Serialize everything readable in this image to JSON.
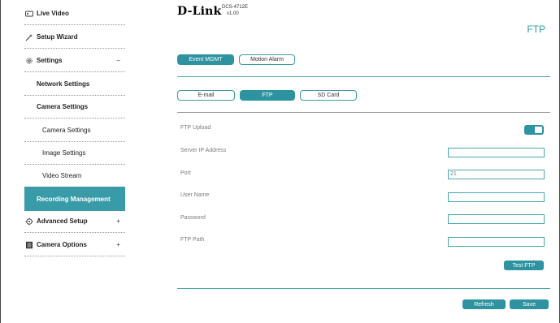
{
  "sidebar": {
    "items": [
      {
        "label": "Live Video",
        "icon": "live-video-icon"
      },
      {
        "label": "Setup Wizard",
        "icon": "wizard-icon"
      },
      {
        "label": "Settings",
        "icon": "gear-icon",
        "sign": "–"
      },
      {
        "label": "Network Settings"
      },
      {
        "label": "Camera Settings"
      },
      {
        "label": "Camera Settings"
      },
      {
        "label": "Image Settings"
      },
      {
        "label": "Video Stream"
      },
      {
        "label": "Recording Management"
      },
      {
        "label": "Advanced Setup",
        "icon": "advanced-setup-icon",
        "sign": "+"
      },
      {
        "label": "Camera Options",
        "icon": "camera-options-icon",
        "sign": "+"
      }
    ]
  },
  "header": {
    "logo": "D-Link",
    "model": "DCS-4712E",
    "version": "v1.00",
    "page_title": "FTP"
  },
  "tabs": {
    "primary": [
      "Event MGMT",
      "Motion Alarm"
    ],
    "secondary": [
      "E-mail",
      "FTP",
      "SD Card"
    ]
  },
  "form": {
    "ftp_upload": "FTP Upload",
    "server_ip": "Server IP Address",
    "port": "Port",
    "port_value": "21",
    "user_name": "User Name",
    "password": "Password",
    "ftp_path": "FTP Path",
    "test_button": "Test FTP"
  },
  "footer": {
    "refresh": "Refresh",
    "save": "Save"
  },
  "colors": {
    "accent": "#2e93a0",
    "active_nav": "#3a9ba8"
  }
}
